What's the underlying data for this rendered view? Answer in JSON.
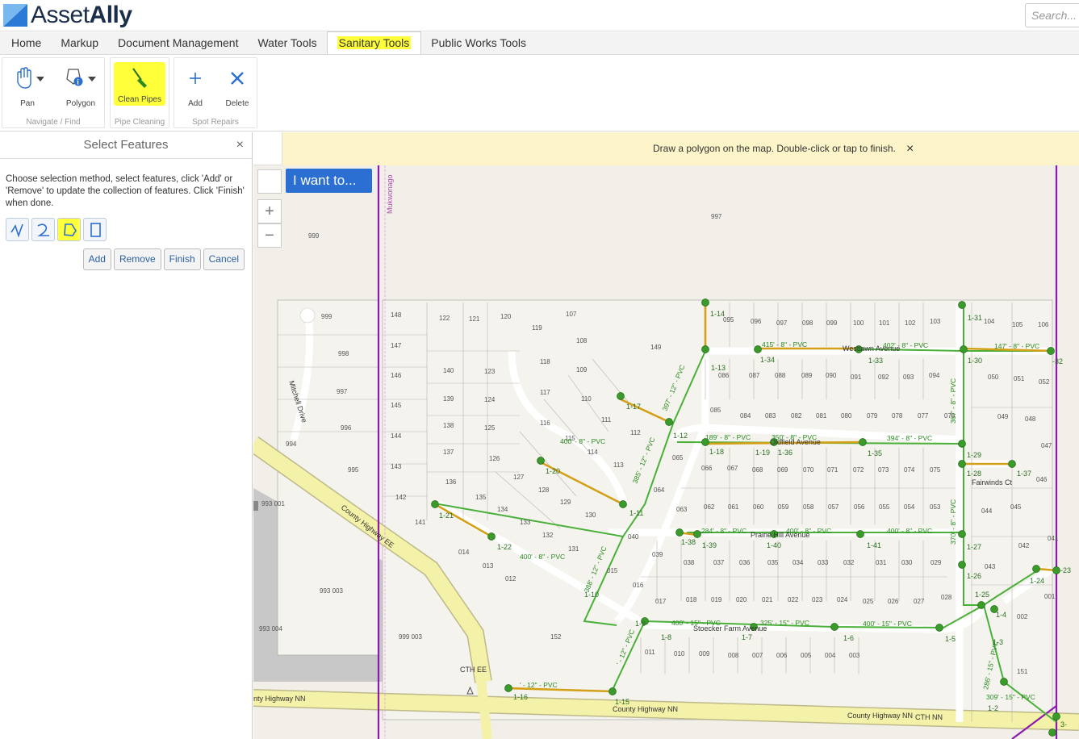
{
  "header": {
    "logo": {
      "text_a": "Asset",
      "text_b": "Ally"
    },
    "search_placeholder": "Search..."
  },
  "tabs": [
    {
      "label": "Home"
    },
    {
      "label": "Markup"
    },
    {
      "label": "Document Management"
    },
    {
      "label": "Water Tools"
    },
    {
      "label": "Sanitary Tools",
      "active": true
    },
    {
      "label": "Public Works Tools"
    }
  ],
  "ribbon": {
    "navigate": {
      "label": "Navigate / Find",
      "pan": "Pan",
      "polygon": "Polygon"
    },
    "pipe_cleaning": {
      "label": "Pipe Cleaning",
      "clean_pipes": "Clean Pipes"
    },
    "spot_repairs": {
      "label": "Spot Repairs",
      "add": "Add",
      "delete": "Delete"
    }
  },
  "panel": {
    "title": "Select Features",
    "close": "×",
    "instructions": "Choose selection method, select features, click 'Add' or 'Remove' to update the collection of features. Click 'Finish' when done.",
    "methods": [
      {
        "icon": "line-select-icon"
      },
      {
        "icon": "freehand-select-icon"
      },
      {
        "icon": "polygon-select-icon",
        "active": true
      },
      {
        "icon": "rectangle-select-icon"
      }
    ],
    "buttons": {
      "add": "Add",
      "remove": "Remove",
      "finish": "Finish",
      "cancel": "Cancel"
    }
  },
  "map": {
    "banner": "Draw a polygon on the map. Double-click or tap to finish.",
    "banner_close": "×",
    "i_want_to": "I want to...",
    "zoom_in": "+",
    "zoom_out": "−",
    "collapse": "<",
    "boundary_label": "Mukwonago",
    "roads": [
      "Mitchell Drive",
      "County Highway EE",
      "County Highway NN",
      "CTH EE",
      "CTH NN",
      "Westlawn Avenue",
      "Oldfield Avenue",
      "Prairie Hill Avenue",
      "Stoecker Farm Avenue",
      "Fairwinds Ct"
    ],
    "parcels": [
      "997",
      "999",
      "998",
      "996",
      "995",
      "994",
      "993 001",
      "993 003",
      "993 004",
      "999 003",
      "148",
      "147",
      "146",
      "145",
      "144",
      "143",
      "142",
      "141",
      "122",
      "121",
      "120",
      "119",
      "107",
      "108",
      "109",
      "110",
      "111",
      "112",
      "113",
      "114",
      "115",
      "116",
      "117",
      "118",
      "140",
      "139",
      "138",
      "137",
      "136",
      "135",
      "134",
      "133",
      "132",
      "131",
      "130",
      "129",
      "128",
      "127",
      "126",
      "125",
      "124",
      "123",
      "149",
      "152",
      "014",
      "013",
      "012",
      "015",
      "016",
      "017",
      "018",
      "019",
      "020",
      "021",
      "022",
      "023",
      "024",
      "025",
      "026",
      "027",
      "028",
      "029",
      "030",
      "031",
      "032",
      "033",
      "034",
      "035",
      "036",
      "037",
      "038",
      "039",
      "040",
      "041",
      "042",
      "043",
      "044",
      "045",
      "046",
      "047",
      "048",
      "049",
      "050",
      "051",
      "052",
      "053",
      "054",
      "055",
      "056",
      "057",
      "058",
      "059",
      "060",
      "061",
      "062",
      "063",
      "064",
      "065",
      "066",
      "067",
      "068",
      "069",
      "070",
      "071",
      "072",
      "073",
      "074",
      "075",
      "076",
      "077",
      "078",
      "079",
      "080",
      "081",
      "082",
      "083",
      "084",
      "085",
      "086",
      "087",
      "088",
      "089",
      "090",
      "091",
      "092",
      "093",
      "094",
      "095",
      "096",
      "097",
      "098",
      "099",
      "100",
      "101",
      "102",
      "103",
      "104",
      "105",
      "106",
      "001",
      "002",
      "003",
      "004",
      "005",
      "006",
      "007",
      "008",
      "009",
      "010",
      "011",
      "151"
    ],
    "pipes": [
      "415' - 8\" - PVC",
      "402' - 8\" - PVC",
      "147' - 8\" - PVC",
      "189' - 8\" - PVC",
      "350' - 8\" - PVC",
      "394' - 8\" - PVC",
      "284' - 8\" - PVC",
      "400' - 8\" - PVC",
      "400' - 8\" - PVC",
      "400' - 15\" - PVC",
      "325' - 15\" - PVC",
      "400' - 15\" - PVC",
      "400' - 8\" - PVC",
      "400' - 8\" - PVC",
      "388' - 12\" - PVC",
      "385' - 12\" - PVC",
      "397' - 12\" - PVC",
      "' - 12\" - PVC",
      "309' - 15\" - PVC",
      "286' - 15\" - PVC",
      "367' - 8\" - PVC",
      "370' - 8\" - PVC",
      "' - 12\" - PVC"
    ],
    "nodes": [
      "1-14",
      "1-13",
      "1-12",
      "1-17",
      "1-34",
      "1-33",
      "1-31",
      "1-30",
      "-32",
      "1-18",
      "1-16",
      "1-19",
      "1-36",
      "1-35",
      "1-29",
      "1-28",
      "1-37",
      "1-20",
      "1-21",
      "1-22",
      "1-11",
      "1-38",
      "1-39",
      "1-40",
      "1-41",
      "1-27",
      "1-26",
      "1-25",
      "1-24",
      "-23",
      "1-10",
      "1-9",
      "1-8",
      "1-7",
      "1-6",
      "1-5",
      "1-4",
      "1-3",
      "1-2",
      "1-16",
      "1-15",
      "3-"
    ]
  },
  "colors": {
    "highlight": "#ffff3a",
    "boundary": "#8a1ab0",
    "pipe_selected": "#d4a017",
    "pipe": "#4ab03a",
    "manhole": "#3a9a2a",
    "road_major": "#f4f1a8",
    "water_grey": "#c8c8c8",
    "button_blue": "#2a6fd1"
  }
}
